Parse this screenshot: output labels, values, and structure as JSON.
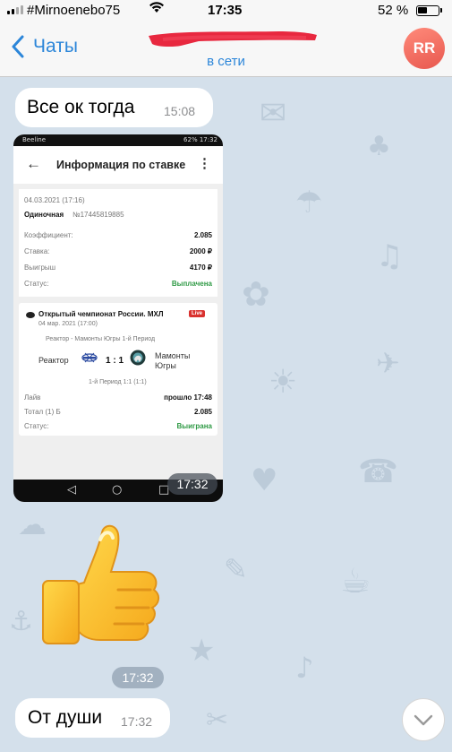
{
  "status_bar": {
    "carrier": "#Mirnoenebo75",
    "time": "17:35",
    "battery": "52 %",
    "battery_level": 0.52,
    "wifi_icon": "wifi-icon"
  },
  "header": {
    "back_label": "Чаты",
    "status": "в сети",
    "avatar_initials": "RR",
    "avatar_color": "#ee6f64",
    "accent": "#2c86d9"
  },
  "messages": [
    {
      "text": "Все ок тогда",
      "time": "15:08"
    },
    {
      "type": "image",
      "time": "17:32",
      "screenshot": {
        "status_left": "Beeline",
        "status_right": "62% 17:32",
        "title": "Информация по ставке",
        "date": "04.03.2021 (17:16)",
        "bet_type": "Одиночная",
        "bet_id": "№17445819885",
        "rows": [
          {
            "label": "Коэффициент:",
            "value": "2.085"
          },
          {
            "label": "Ставка:",
            "value": "2000 ₽"
          },
          {
            "label": "Выигрыш",
            "value": "4170 ₽"
          },
          {
            "label": "Статус:",
            "value": "Выплачена"
          }
        ],
        "event": {
          "league": "Открытый чемпионат России. МХЛ",
          "live": "Live",
          "date": "04 мар. 2021 (17:00)",
          "match": "Реактор - Мамонты Югры 1-й Период",
          "home": "Реактор",
          "score": "1 : 1",
          "away_line1": "Мамонты",
          "away_line2": "Югры",
          "period": "1-й Период 1:1 (1:1)",
          "details": [
            {
              "label": "Лайв",
              "value": "прошло 17:48"
            },
            {
              "label": "Тотал (1) Б",
              "value": "2.085"
            },
            {
              "label": "Статус:",
              "value": "Выиграна"
            }
          ]
        },
        "nav": [
          "◁",
          "○",
          "□"
        ]
      }
    },
    {
      "type": "sticker",
      "emoji": "thumbs-up",
      "time": "17:32"
    },
    {
      "text": "От души",
      "time": "17:32"
    }
  ],
  "scroll_button_icon": "chevron-down-icon"
}
